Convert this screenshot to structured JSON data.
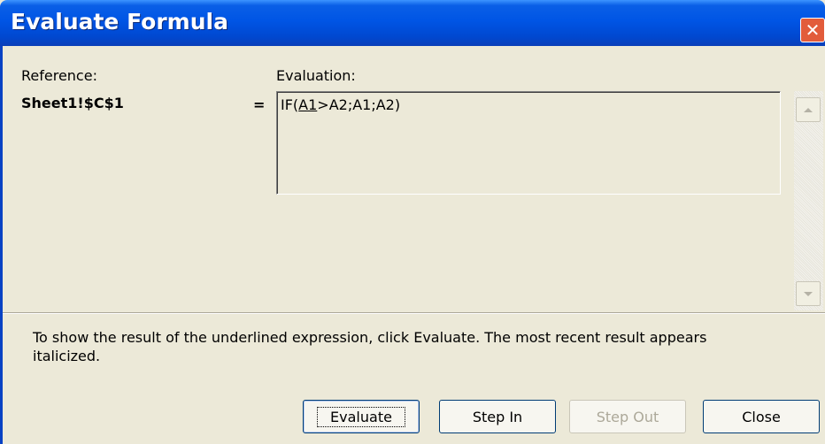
{
  "window": {
    "title": "Evaluate Formula",
    "close_glyph": "✕"
  },
  "reference": {
    "label": "Reference:",
    "value": "Sheet1!$C$1"
  },
  "equals_sign": "=",
  "evaluation": {
    "label": "Evaluation:",
    "formula_prefix": "IF(",
    "formula_underlined": "A1",
    "formula_suffix": ">A2;A1;A2)"
  },
  "help_text": "To show the result of the underlined expression, click Evaluate.  The most recent result appears italicized.",
  "buttons": {
    "evaluate": "Evaluate",
    "step_in": "Step In",
    "step_out": "Step Out",
    "close": "Close"
  }
}
